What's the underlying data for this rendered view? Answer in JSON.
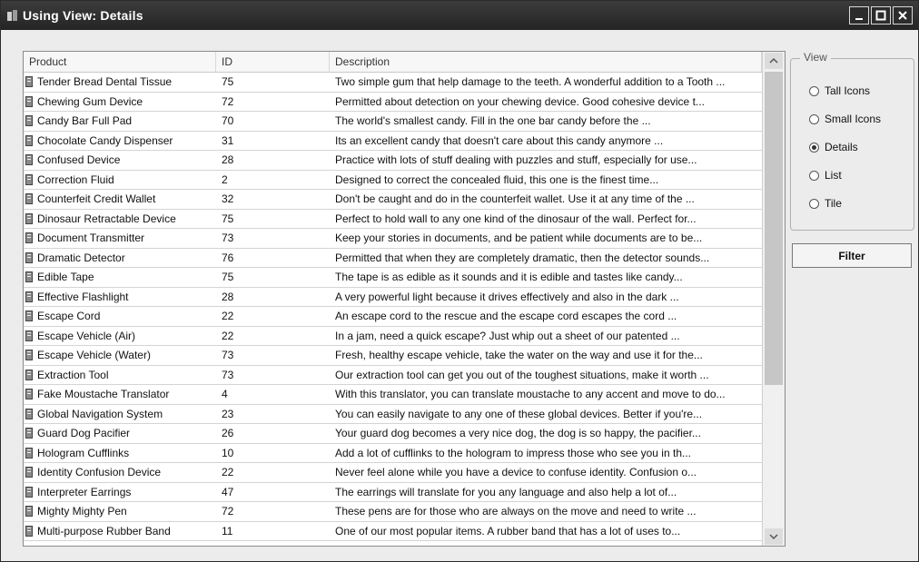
{
  "window": {
    "title": "Using View: Details"
  },
  "table": {
    "columns": [
      "Product",
      "ID",
      "Description"
    ],
    "rows": [
      [
        "Tender Bread Dental Tissue",
        "75",
        "Two simple gum that help damage to the teeth. A wonderful addition to a Tooth ..."
      ],
      [
        "Chewing Gum Device",
        "72",
        "Permitted about detection on your chewing device. Good cohesive device t..."
      ],
      [
        "Candy Bar Full Pad",
        "70",
        "The world's smallest candy. Fill in the one bar candy before the ..."
      ],
      [
        "Chocolate Candy Dispenser",
        "31",
        "Its an excellent candy that doesn't care about this candy anymore ..."
      ],
      [
        "Confused Device",
        "28",
        "Practice with lots of stuff dealing with puzzles and stuff, especially for use..."
      ],
      [
        "Correction Fluid",
        "2",
        "Designed to correct the concealed fluid, this one is the finest time..."
      ],
      [
        "Counterfeit Credit Wallet",
        "32",
        "Don't be caught and do in the counterfeit wallet. Use it at any time of the ..."
      ],
      [
        "Dinosaur Retractable Device",
        "75",
        "Perfect to hold wall to any one kind of the dinosaur of the wall. Perfect for..."
      ],
      [
        "Document Transmitter",
        "73",
        "Keep your stories in documents, and be patient while documents are to be..."
      ],
      [
        "Dramatic Detector",
        "76",
        "Permitted that when they are completely dramatic, then the detector sounds..."
      ],
      [
        "Edible Tape",
        "75",
        "The tape is as edible as it sounds and it is edible and tastes like candy..."
      ],
      [
        "Effective Flashlight",
        "28",
        "A very powerful light because it drives effectively and also in the dark ..."
      ],
      [
        "Escape Cord",
        "22",
        "An escape cord to the rescue and the escape cord escapes the cord ..."
      ],
      [
        "Escape Vehicle (Air)",
        "22",
        "In a jam, need a quick escape? Just whip out a sheet of our patented ..."
      ],
      [
        "Escape Vehicle (Water)",
        "73",
        "Fresh, healthy escape vehicle, take the water on the way and use it for the..."
      ],
      [
        "Extraction Tool",
        "73",
        "Our extraction tool can get you out of the toughest situations, make it worth ..."
      ],
      [
        "Fake Moustache Translator",
        "4",
        "With this translator, you can translate moustache to any accent and move to do..."
      ],
      [
        "Global Navigation System",
        "23",
        "You can easily navigate to any one of these global devices. Better if you're..."
      ],
      [
        "Guard Dog Pacifier",
        "26",
        "Your guard dog becomes a very nice dog, the dog is so happy, the pacifier..."
      ],
      [
        "Hologram Cufflinks",
        "10",
        "Add a lot of cufflinks to the hologram to impress those who see you in th..."
      ],
      [
        "Identity Confusion Device",
        "22",
        "Never feel alone while you have a device to confuse identity. Confusion o..."
      ],
      [
        "Interpreter Earrings",
        "47",
        "The earrings will translate for you any language and also help a lot of..."
      ],
      [
        "Mighty Mighty Pen",
        "72",
        "These pens are for those who are always on the move and need to write ..."
      ],
      [
        "Multi-purpose Rubber Band",
        "11",
        "One of our most popular items. A rubber band that has a lot of uses to..."
      ]
    ]
  },
  "options": {
    "group_label": "View",
    "radios": [
      {
        "label": "Tall Icons",
        "checked": false
      },
      {
        "label": "Small Icons",
        "checked": false
      },
      {
        "label": "Details",
        "checked": true
      },
      {
        "label": "List",
        "checked": false
      },
      {
        "label": "Tile",
        "checked": false
      }
    ],
    "filter_label": "Filter"
  },
  "colors": {
    "titlebar": "#2e2e2e",
    "row_icon": "#666666"
  }
}
